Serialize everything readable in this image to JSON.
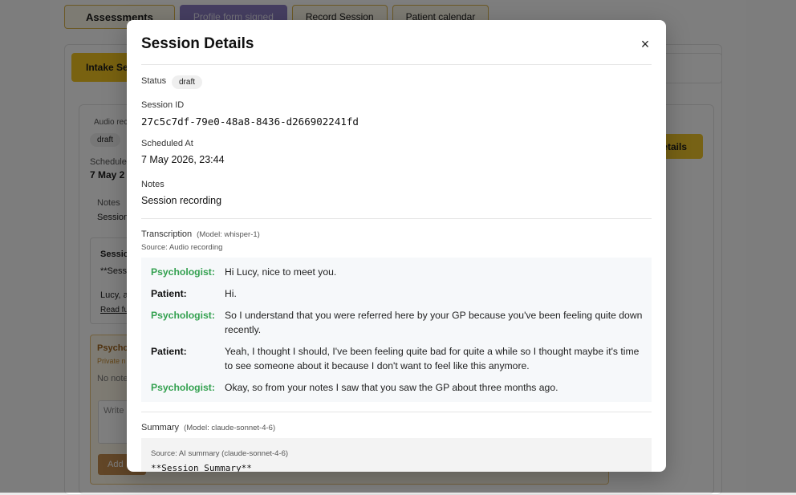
{
  "background": {
    "tabs": [
      "Assessments",
      "Profile form signed",
      "Record Session",
      "Patient calendar"
    ],
    "intake_tab": "Intake Ses",
    "audio_label": "Audio reco",
    "status_badge": "draft",
    "scheduled_label": "Schedule",
    "scheduled_value": "7 May 2",
    "notes_label": "Notes",
    "notes_value": "Session",
    "session_snip_title": "Sessio",
    "session_snip_body": "**Sess",
    "session_snip_name": "Lucy, a",
    "read_more": "Read fu",
    "psych_title": "Psycho",
    "psych_sub": "Private n",
    "no_notes": "No note",
    "write_placeholder": "Write",
    "add_button": "Add",
    "details_button": "etails"
  },
  "modal": {
    "title": "Session Details",
    "close_glyph": "×",
    "status_label": "Status",
    "status_value": "draft",
    "session_id_label": "Session ID",
    "session_id_value": "27c5c7df-79e0-48a8-8436-d266902241fd",
    "scheduled_label": "Scheduled At",
    "scheduled_value": "7 May 2026, 23:44",
    "notes_label": "Notes",
    "notes_value": "Session recording",
    "transcription": {
      "label": "Transcription",
      "model": "(Model: whisper-1)",
      "source": "Source: Audio recording",
      "lines": [
        {
          "speaker": "Psychologist:",
          "role": "psy",
          "text": "Hi Lucy, nice to meet you."
        },
        {
          "speaker": "Patient:",
          "role": "pat",
          "text": "Hi."
        },
        {
          "speaker": "Psychologist:",
          "role": "psy",
          "text": "So I understand that you were referred here by your GP because you've been feeling quite down recently."
        },
        {
          "speaker": "Patient:",
          "role": "pat",
          "text": "Yeah, I thought I should, I've been feeling quite bad for quite a while so I thought maybe it's time to see someone about it because I don't want to feel like this anymore."
        },
        {
          "speaker": "Psychologist:",
          "role": "psy",
          "text": "Okay, so from your notes I saw that you saw the GP about three months ago."
        }
      ]
    },
    "summary": {
      "label": "Summary",
      "model": "(Model: claude-sonnet-4-6)",
      "source": "Source: AI summary (claude-sonnet-4-6)",
      "text": "**Session Summary**"
    }
  },
  "colors": {
    "psychologist": "#34a150",
    "accent_yellow": "#f2c520",
    "overlay": "rgba(0,0,0,0.5)"
  }
}
